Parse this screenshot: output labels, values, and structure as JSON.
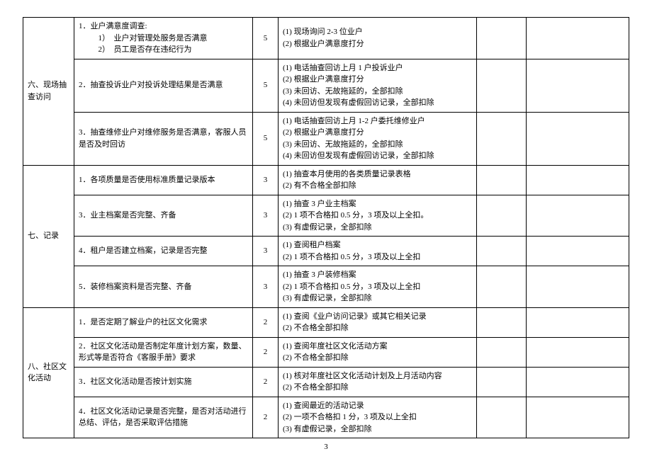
{
  "page_number": "3",
  "sections": [
    {
      "category": "六、现场抽查访问",
      "rows": [
        {
          "item_main": "1．业户满意度调查:",
          "item_sub1": "1）　业户对管理处服务是否满意",
          "item_sub2": "2）　员工是否存在违纪行为",
          "score": "5",
          "criteria": "(1) 现场询问 2-3 位业户\n(2) 根据业户满意度打分"
        },
        {
          "item_main": "2．抽查投诉业户对投诉处理结果是否满意",
          "score": "5",
          "criteria": "(1) 电话抽查回访上月 1 户投诉业户\n(2) 根据业户满意度打分\n(3) 未回访、无故拖延的，全部扣除\n(4) 未回访但发现有虚假回访记录，全部扣除"
        },
        {
          "item_main": "3．抽查维修业户对维修服务是否满意，客服人员是否及时回访",
          "score": "5",
          "criteria": "(1) 电话抽查回访上月 1-2 户委托维修业户\n(2) 根据业户满意度打分\n(3) 未回访、无故拖延的，全部扣除\n(4) 未回访但发现有虚假回访记录，全部扣除"
        }
      ]
    },
    {
      "category": "七、记录",
      "rows": [
        {
          "item_main": "1．各项质量是否使用标准质量记录版本",
          "score": "3",
          "criteria": "(1) 抽查本月使用的各类质量记录表格\n(2) 有不合格全部扣除"
        },
        {
          "item_main": "3．业主档案是否完整、齐备",
          "score": "3",
          "criteria": "(1) 抽查 3 户业主档案\n(2) 1 项不合格扣 0.5 分，3 项及以上全扣。\n(3) 有虚假记录，全部扣除"
        },
        {
          "item_main": "4．租户是否建立档案，记录是否完整",
          "score": "3",
          "criteria": "(1) 查阅租户档案\n(2) 1 项不合格扣 0.5 分，3 项及以上全扣"
        },
        {
          "item_main": "5．装修档案资料是否完整、齐备",
          "score": "3",
          "criteria": "(1) 抽查 3 户装修档案\n(2) 1 项不合格扣 0.5 分，3 项及以上全扣\n(3) 有虚假记录，全部扣除"
        }
      ]
    },
    {
      "category": "八、社区文化活动",
      "rows": [
        {
          "item_main": "1．是否定期了解业户的社区文化需求",
          "score": "2",
          "criteria": "(1) 查阅《业户访问记录》或其它相关记录\n(2) 不合格全部扣除"
        },
        {
          "item_main": "2．社区文化活动是否制定年度计划方案，数量、形式等是否符合《客服手册》要求",
          "score": "2",
          "criteria": "(1) 查阅年度社区文化活动方案\n(2) 不合格全部扣除"
        },
        {
          "item_main": "3．社区文化活动是否按计划实施",
          "score": "2",
          "criteria": "(1) 核对年度社区文化活动计划及上月活动内容\n(2) 不合格全部扣除"
        },
        {
          "item_main": "4．社区文化活动记录是否完整，是否对活动进行总结、评估，是否采取评估措施",
          "score": "2",
          "criteria": "(1) 查阅最近的活动记录\n(2) 一项不合格扣 1 分，3 项及以上全扣\n(3) 有虚假记录，全部扣除"
        }
      ]
    }
  ]
}
